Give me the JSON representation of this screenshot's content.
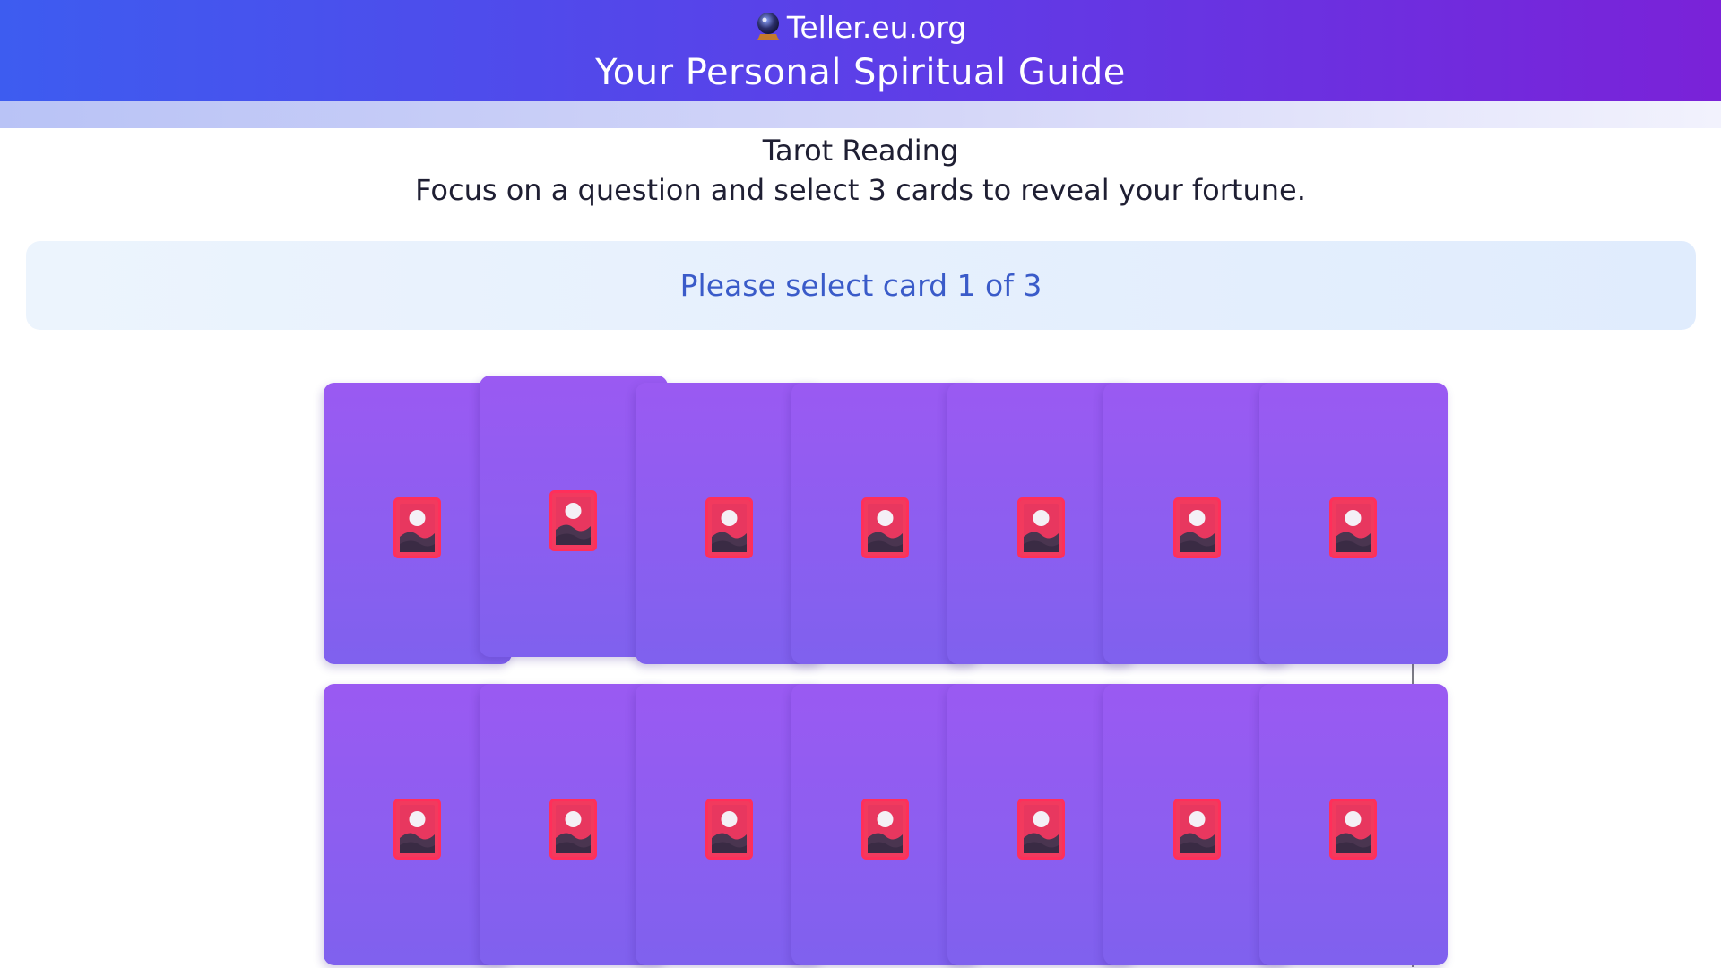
{
  "header": {
    "brand_icon": "crystal-ball-icon",
    "brand_name": "Teller.eu.org",
    "tagline": "Your Personal Spiritual Guide",
    "colors": {
      "gradient_start": "#3d5cf0",
      "gradient_end": "#7a22d8"
    }
  },
  "reading": {
    "title": "Tarot Reading",
    "instructions": "Focus on a question and select 3 cards to reveal your fortune."
  },
  "status": {
    "message": "Please select card 1 of 3",
    "color": "#3a5bc9"
  },
  "deck": {
    "card_back_icon": "tarot-card-back-icon",
    "card_color": "#8c5ef0",
    "symbol_color": "#f23a5e",
    "rows": [
      {
        "cards": [
          {
            "hovered": false
          },
          {
            "hovered": true
          },
          {
            "hovered": false
          },
          {
            "hovered": false
          },
          {
            "hovered": false
          },
          {
            "hovered": false
          },
          {
            "hovered": false
          }
        ]
      },
      {
        "cards": [
          {
            "hovered": false
          },
          {
            "hovered": false
          },
          {
            "hovered": false
          },
          {
            "hovered": false
          },
          {
            "hovered": false
          },
          {
            "hovered": false
          },
          {
            "hovered": false
          }
        ]
      }
    ]
  }
}
